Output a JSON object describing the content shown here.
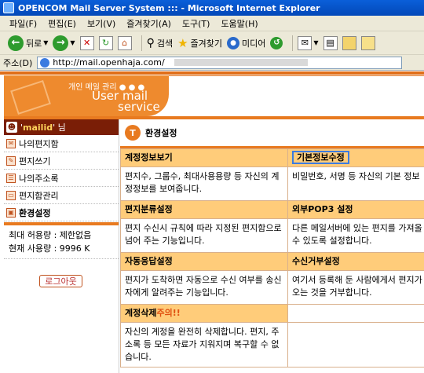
{
  "window": {
    "title": "OPENCOM Mail Server System ::: - Microsoft Internet Explorer"
  },
  "menu": [
    "파일(F)",
    "편집(E)",
    "보기(V)",
    "즐겨찾기(A)",
    "도구(T)",
    "도움말(H)"
  ],
  "toolbar": {
    "back": "뒤로",
    "search": "검색",
    "favorites": "즐겨찾기",
    "media": "미디어"
  },
  "address": {
    "label": "주소(D)",
    "url": "http://mail.openhaja.com/"
  },
  "logo": {
    "line1": "개인 메일 관리  ● ● ●",
    "line2": "User mail",
    "line3": "service"
  },
  "user": {
    "id": "mailid",
    "suffix": "님"
  },
  "nav": [
    {
      "label": "나의편지함",
      "icon": "mailbox-icon"
    },
    {
      "label": "편지쓰기",
      "icon": "pencil-icon"
    },
    {
      "label": "나의주소록",
      "icon": "addressbook-icon"
    },
    {
      "label": "편지함관리",
      "icon": "folder-icon"
    },
    {
      "label": "환경설정",
      "icon": "settings-icon"
    }
  ],
  "quota": {
    "max": "최대 허용량 : 제한없음",
    "used": "현재 사용량 : 9996 K"
  },
  "logout": "로그아웃",
  "section": {
    "title": "환경설정"
  },
  "settings": {
    "account_info": {
      "title": "계정정보보기",
      "desc": "편지수, 그룹수, 최대사용용량 등 자신의 계정정보를 보여줍니다."
    },
    "basic_info": {
      "title": "기본정보수정",
      "desc": "비밀번호, 서명 등 자신의 기본 정보"
    },
    "letter_sort": {
      "title": "편지분류설정",
      "desc": "편지 수신시 규칙에 따라 지정된 편지함으로 넘어 주는 기능입니다."
    },
    "external_pop3": {
      "title": "외부POP3 설정",
      "desc": "다른 메일서버에 있는 편지를 가져올 수 있도록 설정합니다."
    },
    "auto_reply": {
      "title": "자동응답설정",
      "desc": "편지가 도착하면 자동으로 수신 여부를 송신자에게 알려주는 기능입니다."
    },
    "reject": {
      "title": "수신거부설정",
      "desc": "여기서 등록해 둔 사람에게서 편지가 오는 것을 거부합니다."
    },
    "delete_account": {
      "title": "계정삭제",
      "warn": "주의!!",
      "desc": "자신의 계정을 완전히 삭제합니다. 편지, 주소록 등 모든 자료가 지워지며 복구할 수 없습니다."
    }
  }
}
